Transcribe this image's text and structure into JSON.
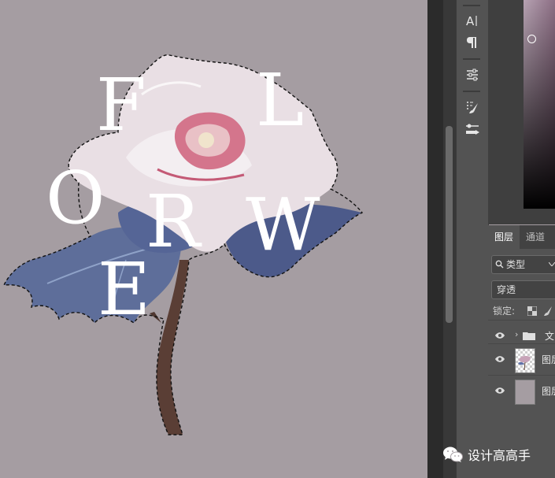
{
  "canvas": {
    "letters": [
      "F",
      "L",
      "O",
      "R",
      "W",
      "E"
    ],
    "background": "#a59da2"
  },
  "tools": [
    {
      "icon": "character-icon",
      "glyph": "A|"
    },
    {
      "icon": "paragraph-icon",
      "glyph": "¶"
    },
    {
      "icon": "adjustments-icon",
      "glyph": ""
    },
    {
      "icon": "brush-settings-icon",
      "glyph": ""
    },
    {
      "icon": "tool-presets-icon",
      "glyph": ""
    }
  ],
  "layers_panel": {
    "tabs": [
      "图层",
      "通道"
    ],
    "filter_label": "类型",
    "blend_mode": "穿透",
    "lock_label": "锁定:",
    "layers": [
      {
        "name": "文",
        "type": "group",
        "icon": "folder-icon"
      },
      {
        "name": "图层",
        "type": "layer",
        "icon": "flower-thumbnail"
      },
      {
        "name": "图层",
        "type": "layer",
        "icon": "solid-thumbnail"
      }
    ]
  },
  "watermark": {
    "text": "设计高高手",
    "icon": "wechat-icon"
  },
  "colors": {
    "canvas_bg": "#a59da2",
    "panel_bg": "#535353",
    "dark_bg": "#2b2b2b",
    "accent_pink": "#c45a76"
  }
}
